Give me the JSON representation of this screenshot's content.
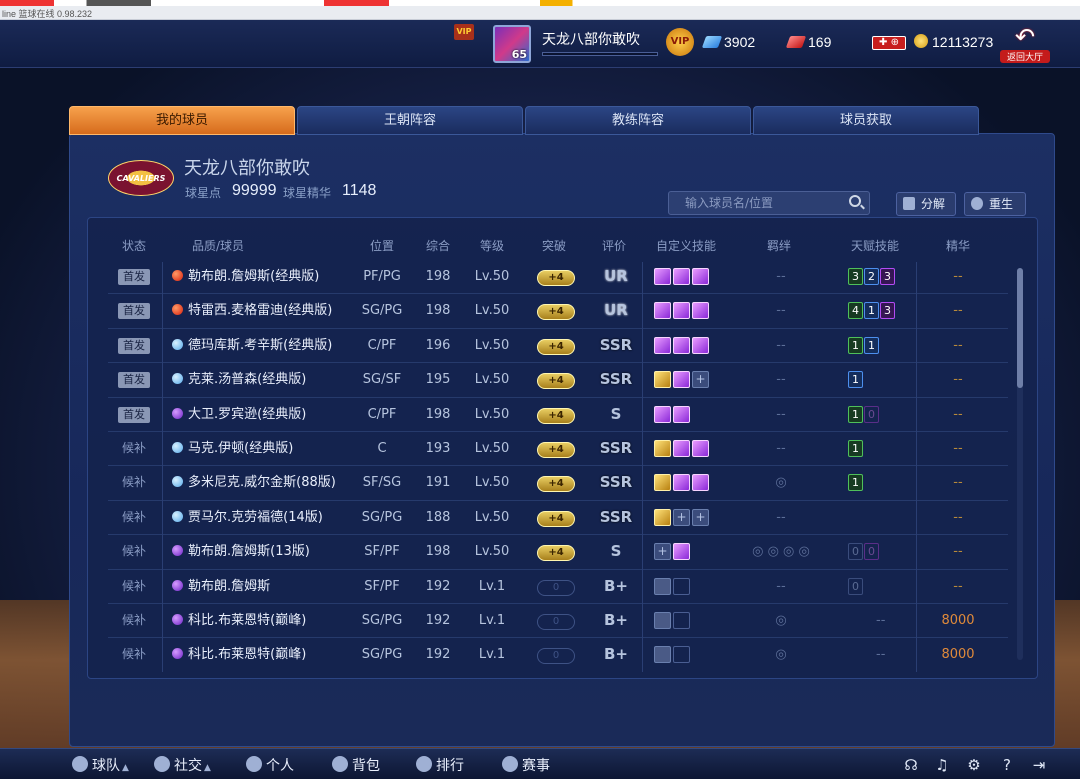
{
  "browser": {
    "status": "line 篮球在线 0.98.232"
  },
  "topbar": {
    "vip_small": "VIP",
    "avatar_level": "65",
    "player_name": "天龙八部你敢吹",
    "vip_badge": "VIP",
    "gems_blue": "3902",
    "gems_red": "169",
    "coins": "12113273",
    "back_label": "返回大厅"
  },
  "tabs": [
    {
      "label": "我的球员",
      "active": true
    },
    {
      "label": "王朝阵容"
    },
    {
      "label": "教练阵容"
    },
    {
      "label": "球员获取"
    }
  ],
  "team": {
    "logo_text": "CAVALIERS",
    "name": "天龙八部你敢吹",
    "star_points_label": "球星点",
    "star_points": "99999",
    "essence_label": "球星精华",
    "essence": "1148"
  },
  "search": {
    "placeholder": "输入球员名/位置"
  },
  "buttons": {
    "decompose": "分解",
    "reborn": "重生"
  },
  "columns": [
    "状态",
    "品质/球员",
    "位置",
    "综合",
    "等级",
    "突破",
    "评价",
    "自定义技能",
    "羁绊",
    "天赋技能",
    "精华"
  ],
  "players": [
    {
      "status": "首发",
      "quality": "red",
      "name": "勒布朗.詹姆斯(经典版)",
      "pos": "PF/PG",
      "ovr": "198",
      "lvl": "Lv.50",
      "brk": "+4",
      "grade": "UR",
      "skills": [
        "p",
        "p",
        "p"
      ],
      "bond": "--",
      "talents": [
        [
          "3",
          "g"
        ],
        [
          "2",
          "b"
        ],
        [
          "3",
          "p"
        ]
      ],
      "ess": "--"
    },
    {
      "status": "首发",
      "quality": "red",
      "name": "特雷西.麦格雷迪(经典版)",
      "pos": "SG/PG",
      "ovr": "198",
      "lvl": "Lv.50",
      "brk": "+4",
      "grade": "UR",
      "skills": [
        "p",
        "p",
        "p"
      ],
      "bond": "--",
      "talents": [
        [
          "4",
          "g"
        ],
        [
          "1",
          "b"
        ],
        [
          "3",
          "p"
        ]
      ],
      "ess": "--"
    },
    {
      "status": "首发",
      "quality": "blue",
      "name": "德玛库斯.考辛斯(经典版)",
      "pos": "C/PF",
      "ovr": "196",
      "lvl": "Lv.50",
      "brk": "+4",
      "grade": "SSR",
      "skills": [
        "p",
        "p",
        "p"
      ],
      "bond": "--",
      "talents": [
        [
          "1",
          "g"
        ],
        [
          "1",
          "b"
        ]
      ],
      "ess": "--"
    },
    {
      "status": "首发",
      "quality": "blue",
      "name": "克莱.汤普森(经典版)",
      "pos": "SG/SF",
      "ovr": "195",
      "lvl": "Lv.50",
      "brk": "+4",
      "grade": "SSR",
      "skills": [
        "g",
        "p",
        "add"
      ],
      "bond": "--",
      "talents": [
        [
          "1",
          "b"
        ]
      ],
      "ess": "--"
    },
    {
      "status": "首发",
      "quality": "purple",
      "name": "大卫.罗宾逊(经典版)",
      "pos": "C/PF",
      "ovr": "198",
      "lvl": "Lv.50",
      "brk": "+4",
      "grade": "S",
      "skills": [
        "p",
        "p"
      ],
      "bond": "--",
      "talents": [
        [
          "1",
          "g"
        ],
        [
          "0",
          "dimp"
        ]
      ],
      "ess": "--"
    },
    {
      "status": "候补",
      "quality": "blue",
      "name": "马克.伊顿(经典版)",
      "pos": "C",
      "ovr": "193",
      "lvl": "Lv.50",
      "brk": "+4",
      "grade": "SSR",
      "skills": [
        "g",
        "p",
        "p"
      ],
      "bond": "--",
      "talents": [
        [
          "1",
          "g"
        ]
      ],
      "ess": "--"
    },
    {
      "status": "候补",
      "quality": "blue",
      "name": "多米尼克.威尔金斯(88版)",
      "pos": "SF/SG",
      "ovr": "191",
      "lvl": "Lv.50",
      "brk": "+4",
      "grade": "SSR",
      "skills": [
        "g",
        "p",
        "p"
      ],
      "bond": "◎",
      "talents": [
        [
          "1",
          "g"
        ]
      ],
      "ess": "--"
    },
    {
      "status": "候补",
      "quality": "blue",
      "name": "贾马尔.克劳福德(14版)",
      "pos": "SG/PG",
      "ovr": "188",
      "lvl": "Lv.50",
      "brk": "+4",
      "grade": "SSR",
      "skills": [
        "g",
        "add",
        "add"
      ],
      "bond": "--",
      "talents": [],
      "ess": "--"
    },
    {
      "status": "候补",
      "quality": "purple",
      "name": "勒布朗.詹姆斯(13版)",
      "pos": "SF/PF",
      "ovr": "198",
      "lvl": "Lv.50",
      "brk": "+4",
      "grade": "S",
      "skills": [
        "add",
        "p"
      ],
      "bond": "◎ ◎ ◎ ◎",
      "talents": [
        [
          "0",
          "dim"
        ],
        [
          "0",
          "dimp"
        ]
      ],
      "ess": "--"
    },
    {
      "status": "候补",
      "quality": "purple",
      "name": "勒布朗.詹姆斯",
      "pos": "SF/PF",
      "ovr": "192",
      "lvl": "Lv.1",
      "brk": "0",
      "grade": "B+",
      "skills": [
        "lock",
        "emp"
      ],
      "bond": "--",
      "talents": [
        [
          "0",
          "dim"
        ]
      ],
      "ess": "--"
    },
    {
      "status": "候补",
      "quality": "purple",
      "name": "科比.布莱恩特(巅峰)",
      "pos": "SG/PG",
      "ovr": "192",
      "lvl": "Lv.1",
      "brk": "0",
      "grade": "B+",
      "skills": [
        "lock",
        "emp"
      ],
      "bond": "◎",
      "talents": [
        [
          "--",
          "none"
        ]
      ],
      "ess": "8000"
    },
    {
      "status": "候补",
      "quality": "purple",
      "name": "科比.布莱恩特(巅峰)",
      "pos": "SG/PG",
      "ovr": "192",
      "lvl": "Lv.1",
      "brk": "0",
      "grade": "B+",
      "skills": [
        "lock",
        "emp"
      ],
      "bond": "◎",
      "talents": [
        [
          "--",
          "none"
        ]
      ],
      "ess": "8000"
    }
  ],
  "bottom_nav": [
    {
      "label": "球队",
      "caret": true
    },
    {
      "label": "社交",
      "caret": true
    },
    {
      "label": "个人"
    },
    {
      "label": "背包"
    },
    {
      "label": "排行"
    },
    {
      "label": "赛事"
    }
  ],
  "system_icons": [
    "headset-icon",
    "music-icon",
    "gear-icon",
    "help-icon",
    "exit-icon"
  ]
}
